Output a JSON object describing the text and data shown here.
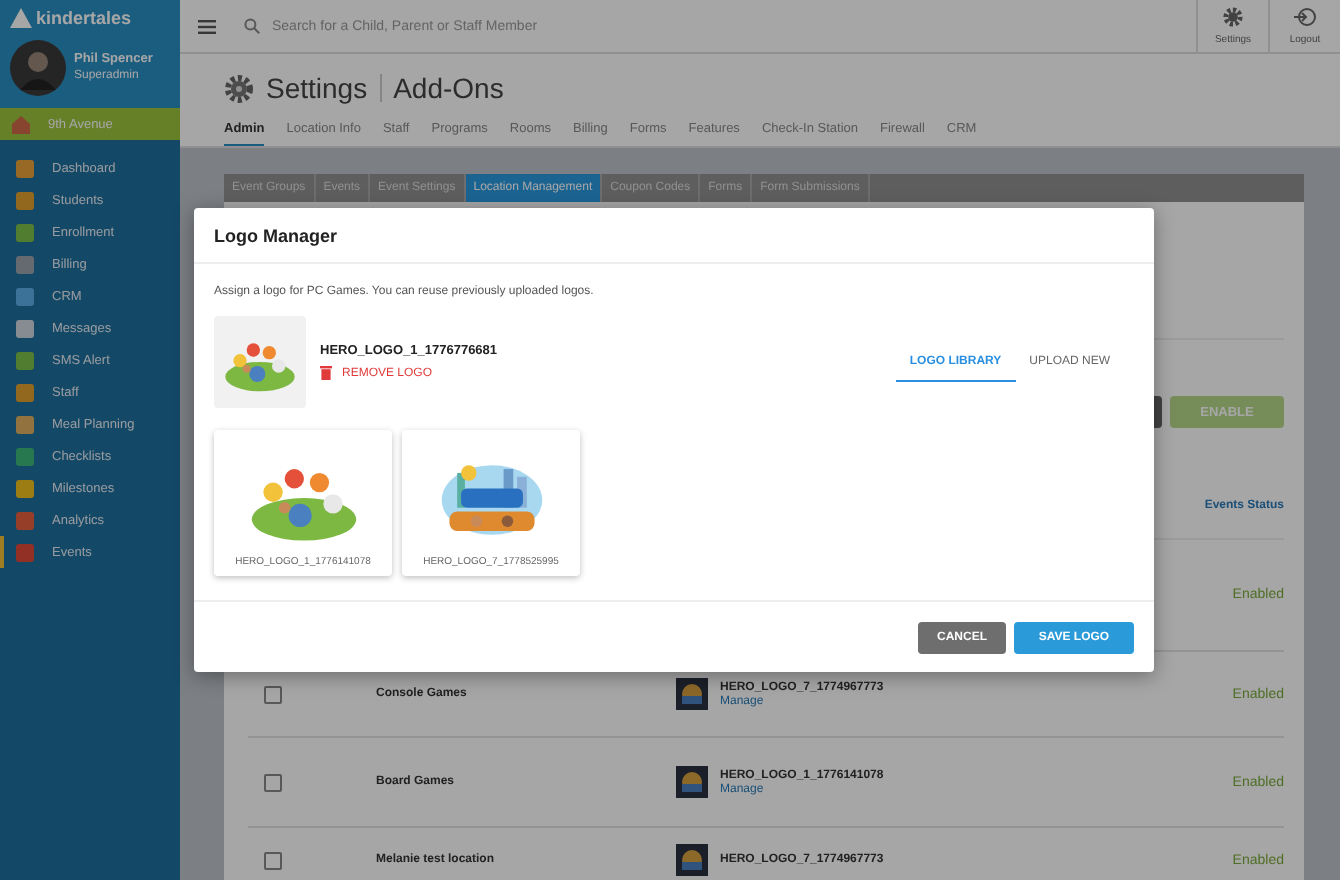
{
  "brand": "kindertales",
  "user": {
    "name": "Phil Spencer",
    "role": "Superadmin"
  },
  "location": "9th Avenue",
  "nav": [
    {
      "label": "Dashboard",
      "selected": false
    },
    {
      "label": "Students",
      "selected": false
    },
    {
      "label": "Enrollment",
      "selected": false
    },
    {
      "label": "Billing",
      "selected": false
    },
    {
      "label": "CRM",
      "selected": false
    },
    {
      "label": "Messages",
      "selected": false
    },
    {
      "label": "SMS Alert",
      "selected": false
    },
    {
      "label": "Staff",
      "selected": false
    },
    {
      "label": "Meal Planning",
      "selected": false
    },
    {
      "label": "Checklists",
      "selected": false
    },
    {
      "label": "Milestones",
      "selected": false
    },
    {
      "label": "Analytics",
      "selected": false
    },
    {
      "label": "Events",
      "selected": true
    }
  ],
  "search": {
    "placeholder": "Search for a Child, Parent or Staff Member"
  },
  "top_actions": [
    {
      "kind": "settings",
      "label": "Settings"
    },
    {
      "kind": "logout",
      "label": "Logout"
    }
  ],
  "page": {
    "title": "Settings",
    "subtitle": "Add-Ons"
  },
  "tabs": [
    {
      "label": "Admin",
      "selected": true
    },
    {
      "label": "Location Info",
      "selected": false
    },
    {
      "label": "Staff",
      "selected": false
    },
    {
      "label": "Programs",
      "selected": false
    },
    {
      "label": "Rooms",
      "selected": false
    },
    {
      "label": "Billing",
      "selected": false
    },
    {
      "label": "Forms",
      "selected": false
    },
    {
      "label": "Features",
      "selected": false
    },
    {
      "label": "Check-In Station",
      "selected": false
    },
    {
      "label": "Firewall",
      "selected": false
    },
    {
      "label": "CRM",
      "selected": false
    }
  ],
  "subtabs": [
    {
      "label": "Event Groups",
      "selected": false
    },
    {
      "label": "Events",
      "selected": false
    },
    {
      "label": "Event Settings",
      "selected": false
    },
    {
      "label": "Location Management",
      "selected": true
    },
    {
      "label": "Coupon Codes",
      "selected": false
    },
    {
      "label": "Forms",
      "selected": false
    },
    {
      "label": "Form Submissions",
      "selected": false
    }
  ],
  "enable_button": "ENABLE",
  "status_heading": "Events Status",
  "rows": [
    {
      "status": "Enabled"
    },
    {
      "checked": false,
      "name": "Console Games",
      "logo": "HERO_LOGO_7_1774967773",
      "link": "Manage",
      "status": "Enabled"
    },
    {
      "checked": false,
      "name": "Board Games",
      "logo": "HERO_LOGO_1_1776141078",
      "link": "Manage",
      "status": "Enabled"
    },
    {
      "checked": false,
      "name": "Melanie test location",
      "logo": "HERO_LOGO_7_1774967773",
      "status": "Enabled"
    }
  ],
  "modal": {
    "title": "Logo Manager",
    "description": "Assign a logo for PC Games. You can reuse previously uploaded logos.",
    "current_logo": "HERO_LOGO_1_1776776681",
    "remove": "REMOVE LOGO",
    "tabs": [
      {
        "label": "LOGO LIBRARY",
        "selected": true
      },
      {
        "label": "UPLOAD NEW",
        "selected": false
      }
    ],
    "library": [
      {
        "kind": "kids",
        "name": "HERO_LOGO_1_1776141078"
      },
      {
        "kind": "city",
        "name": "HERO_LOGO_7_1778525995"
      }
    ],
    "cancel": "CANCEL",
    "save": "SAVE LOGO"
  }
}
